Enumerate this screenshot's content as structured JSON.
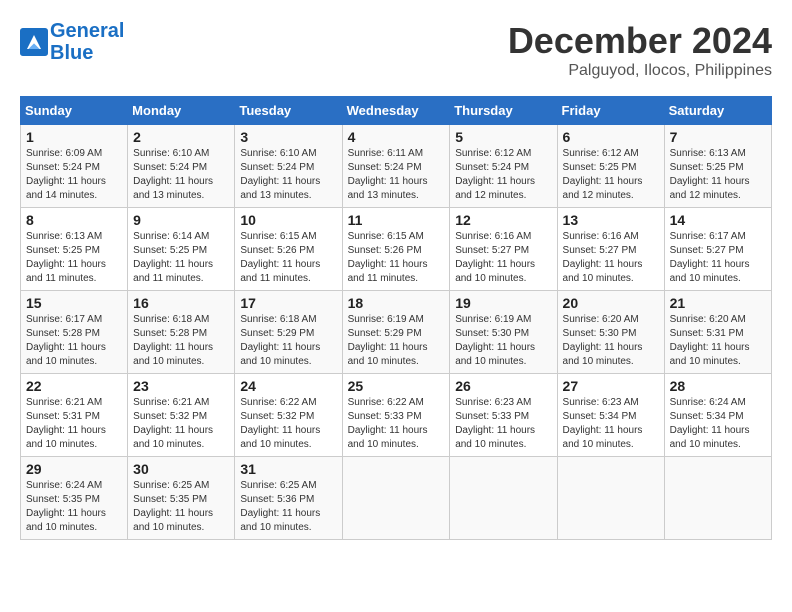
{
  "logo": {
    "line1": "General",
    "line2": "Blue"
  },
  "title": "December 2024",
  "subtitle": "Palguyod, Ilocos, Philippines",
  "headers": [
    "Sunday",
    "Monday",
    "Tuesday",
    "Wednesday",
    "Thursday",
    "Friday",
    "Saturday"
  ],
  "weeks": [
    [
      {
        "day": "1",
        "info": "Sunrise: 6:09 AM\nSunset: 5:24 PM\nDaylight: 11 hours and 14 minutes."
      },
      {
        "day": "2",
        "info": "Sunrise: 6:10 AM\nSunset: 5:24 PM\nDaylight: 11 hours and 13 minutes."
      },
      {
        "day": "3",
        "info": "Sunrise: 6:10 AM\nSunset: 5:24 PM\nDaylight: 11 hours and 13 minutes."
      },
      {
        "day": "4",
        "info": "Sunrise: 6:11 AM\nSunset: 5:24 PM\nDaylight: 11 hours and 13 minutes."
      },
      {
        "day": "5",
        "info": "Sunrise: 6:12 AM\nSunset: 5:24 PM\nDaylight: 11 hours and 12 minutes."
      },
      {
        "day": "6",
        "info": "Sunrise: 6:12 AM\nSunset: 5:25 PM\nDaylight: 11 hours and 12 minutes."
      },
      {
        "day": "7",
        "info": "Sunrise: 6:13 AM\nSunset: 5:25 PM\nDaylight: 11 hours and 12 minutes."
      }
    ],
    [
      {
        "day": "8",
        "info": "Sunrise: 6:13 AM\nSunset: 5:25 PM\nDaylight: 11 hours and 11 minutes."
      },
      {
        "day": "9",
        "info": "Sunrise: 6:14 AM\nSunset: 5:25 PM\nDaylight: 11 hours and 11 minutes."
      },
      {
        "day": "10",
        "info": "Sunrise: 6:15 AM\nSunset: 5:26 PM\nDaylight: 11 hours and 11 minutes."
      },
      {
        "day": "11",
        "info": "Sunrise: 6:15 AM\nSunset: 5:26 PM\nDaylight: 11 hours and 11 minutes."
      },
      {
        "day": "12",
        "info": "Sunrise: 6:16 AM\nSunset: 5:27 PM\nDaylight: 11 hours and 10 minutes."
      },
      {
        "day": "13",
        "info": "Sunrise: 6:16 AM\nSunset: 5:27 PM\nDaylight: 11 hours and 10 minutes."
      },
      {
        "day": "14",
        "info": "Sunrise: 6:17 AM\nSunset: 5:27 PM\nDaylight: 11 hours and 10 minutes."
      }
    ],
    [
      {
        "day": "15",
        "info": "Sunrise: 6:17 AM\nSunset: 5:28 PM\nDaylight: 11 hours and 10 minutes."
      },
      {
        "day": "16",
        "info": "Sunrise: 6:18 AM\nSunset: 5:28 PM\nDaylight: 11 hours and 10 minutes."
      },
      {
        "day": "17",
        "info": "Sunrise: 6:18 AM\nSunset: 5:29 PM\nDaylight: 11 hours and 10 minutes."
      },
      {
        "day": "18",
        "info": "Sunrise: 6:19 AM\nSunset: 5:29 PM\nDaylight: 11 hours and 10 minutes."
      },
      {
        "day": "19",
        "info": "Sunrise: 6:19 AM\nSunset: 5:30 PM\nDaylight: 11 hours and 10 minutes."
      },
      {
        "day": "20",
        "info": "Sunrise: 6:20 AM\nSunset: 5:30 PM\nDaylight: 11 hours and 10 minutes."
      },
      {
        "day": "21",
        "info": "Sunrise: 6:20 AM\nSunset: 5:31 PM\nDaylight: 11 hours and 10 minutes."
      }
    ],
    [
      {
        "day": "22",
        "info": "Sunrise: 6:21 AM\nSunset: 5:31 PM\nDaylight: 11 hours and 10 minutes."
      },
      {
        "day": "23",
        "info": "Sunrise: 6:21 AM\nSunset: 5:32 PM\nDaylight: 11 hours and 10 minutes."
      },
      {
        "day": "24",
        "info": "Sunrise: 6:22 AM\nSunset: 5:32 PM\nDaylight: 11 hours and 10 minutes."
      },
      {
        "day": "25",
        "info": "Sunrise: 6:22 AM\nSunset: 5:33 PM\nDaylight: 11 hours and 10 minutes."
      },
      {
        "day": "26",
        "info": "Sunrise: 6:23 AM\nSunset: 5:33 PM\nDaylight: 11 hours and 10 minutes."
      },
      {
        "day": "27",
        "info": "Sunrise: 6:23 AM\nSunset: 5:34 PM\nDaylight: 11 hours and 10 minutes."
      },
      {
        "day": "28",
        "info": "Sunrise: 6:24 AM\nSunset: 5:34 PM\nDaylight: 11 hours and 10 minutes."
      }
    ],
    [
      {
        "day": "29",
        "info": "Sunrise: 6:24 AM\nSunset: 5:35 PM\nDaylight: 11 hours and 10 minutes."
      },
      {
        "day": "30",
        "info": "Sunrise: 6:25 AM\nSunset: 5:35 PM\nDaylight: 11 hours and 10 minutes."
      },
      {
        "day": "31",
        "info": "Sunrise: 6:25 AM\nSunset: 5:36 PM\nDaylight: 11 hours and 10 minutes."
      },
      null,
      null,
      null,
      null
    ]
  ]
}
